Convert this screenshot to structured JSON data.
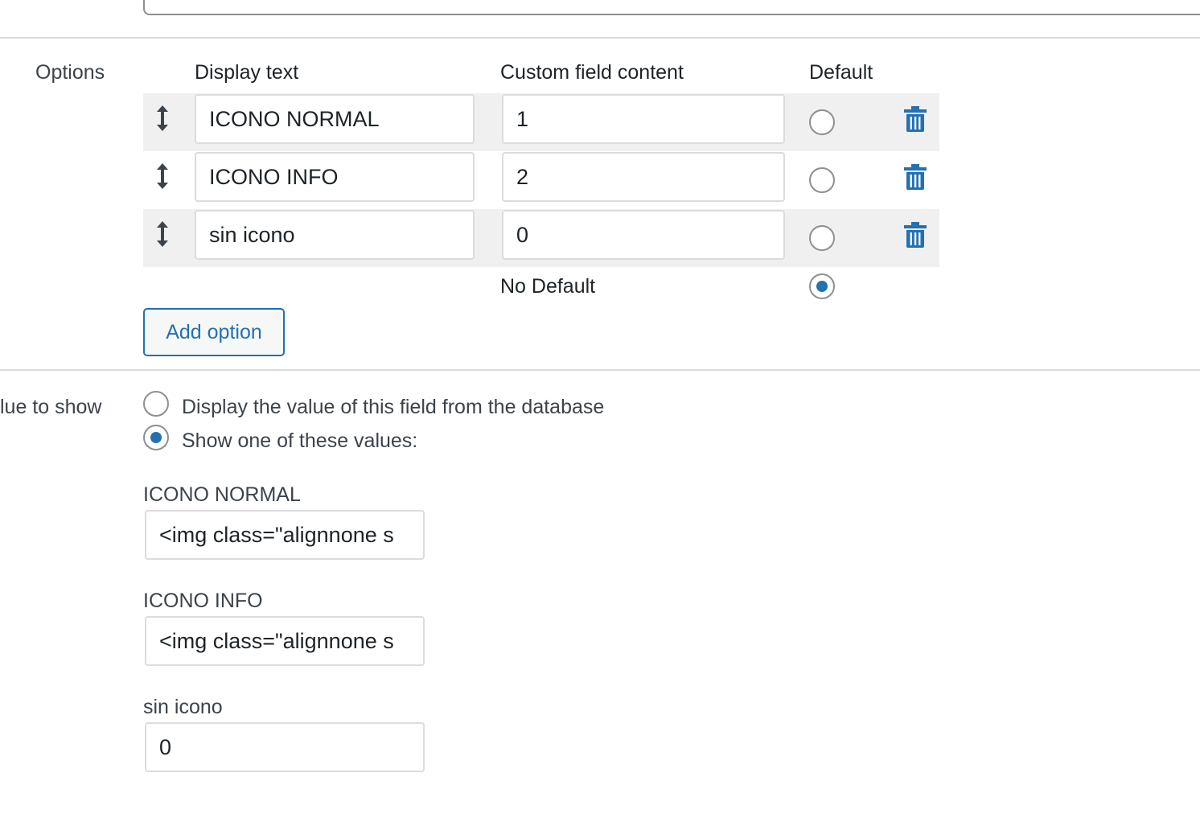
{
  "options_section": {
    "label": "Options",
    "headers": {
      "display_text": "Display text",
      "custom_field_content": "Custom field content",
      "default": "Default"
    },
    "rows": [
      {
        "display_text": "ICONO NORMAL",
        "content": "1",
        "default_selected": false
      },
      {
        "display_text": "ICONO INFO",
        "content": "2",
        "default_selected": false
      },
      {
        "display_text": "sin icono",
        "content": "0",
        "default_selected": false
      }
    ],
    "no_default": {
      "label": "No Default",
      "selected": true
    },
    "add_button_label": "Add option"
  },
  "value_section": {
    "label": "lue to show",
    "choices": [
      {
        "label": "Display the value of this field from the database",
        "selected": false
      },
      {
        "label": "Show one of these values:",
        "selected": true
      }
    ],
    "values": [
      {
        "label": "ICONO NORMAL",
        "value": "<img class=\"alignnone s"
      },
      {
        "label": "ICONO INFO",
        "value": "<img class=\"alignnone s"
      },
      {
        "label": "sin icono",
        "value": "0"
      }
    ]
  },
  "colors": {
    "accent": "#2271b1",
    "row_background": "#f0f0f1",
    "border": "#dcdcde"
  },
  "icons": {
    "drag": "drag-handle-icon",
    "delete": "trash-icon"
  }
}
